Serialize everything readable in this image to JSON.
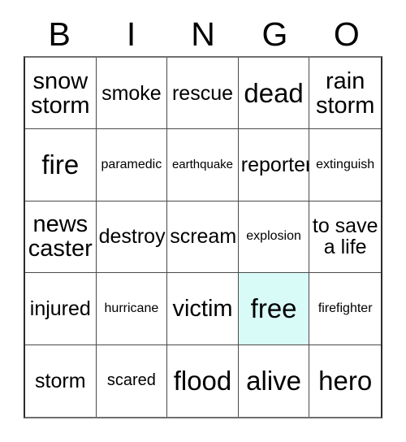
{
  "header": {
    "letters": [
      "B",
      "I",
      "N",
      "G",
      "O"
    ]
  },
  "colors": {
    "free_cell_background": "#d9fbf8",
    "grid_border": "#4a4a4a",
    "text": "#000000",
    "page_background": "#ffffff"
  },
  "grid": {
    "rows": 5,
    "columns": 5,
    "cells": [
      {
        "text": "snow storm",
        "size": "lg",
        "free": false
      },
      {
        "text": "smoke",
        "size": "md",
        "free": false
      },
      {
        "text": "rescue",
        "size": "md",
        "free": false
      },
      {
        "text": "dead",
        "size": "xl",
        "free": false
      },
      {
        "text": "rain storm",
        "size": "lg",
        "free": false
      },
      {
        "text": "fire",
        "size": "xl",
        "free": false
      },
      {
        "text": "paramedic",
        "size": "xs",
        "free": false
      },
      {
        "text": "earthquake",
        "size": "xxs",
        "free": false
      },
      {
        "text": "reporter",
        "size": "md",
        "free": false
      },
      {
        "text": "extinguish",
        "size": "xs",
        "free": false
      },
      {
        "text": "news caster",
        "size": "lg",
        "free": false
      },
      {
        "text": "destroy",
        "size": "md",
        "free": false
      },
      {
        "text": "scream",
        "size": "md",
        "free": false
      },
      {
        "text": "explosion",
        "size": "xs",
        "free": false
      },
      {
        "text": "to save a life",
        "size": "md",
        "free": false
      },
      {
        "text": "injured",
        "size": "md",
        "free": false
      },
      {
        "text": "hurricane",
        "size": "xs",
        "free": false
      },
      {
        "text": "victim",
        "size": "lg",
        "free": false
      },
      {
        "text": "free",
        "size": "xl",
        "free": true
      },
      {
        "text": "firefighter",
        "size": "xs",
        "free": false
      },
      {
        "text": "storm",
        "size": "md",
        "free": false
      },
      {
        "text": "scared",
        "size": "sm",
        "free": false
      },
      {
        "text": "flood",
        "size": "xl",
        "free": false
      },
      {
        "text": "alive",
        "size": "xl",
        "free": false
      },
      {
        "text": "hero",
        "size": "xl",
        "free": false
      }
    ]
  }
}
